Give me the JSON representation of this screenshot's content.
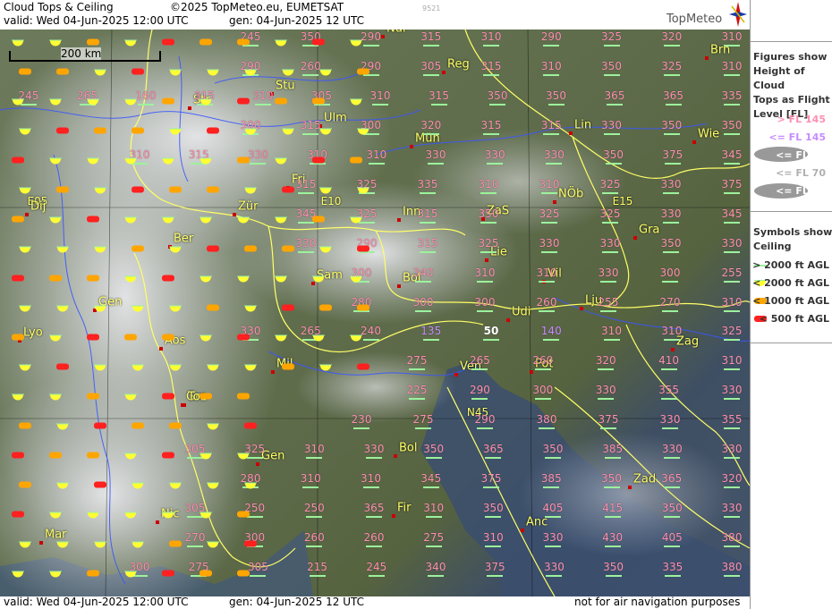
{
  "header": {
    "title": "Cloud Tops & Ceiling",
    "copyright": "©2025 TopMeteo.eu, EUMETSAT",
    "valid": "valid:  Wed  04-Jun-2025  12:00 UTC",
    "generated": "gen: 04-Jun-2025 12 UTC",
    "small_id": "9521",
    "logo": "TopMeteo"
  },
  "footer": {
    "valid": "valid:  Wed  04-Jun-2025  12:00 UTC",
    "generated": "gen:  04-Jun-2025 12 UTC",
    "note": "not for air navigation purposes"
  },
  "map": {
    "scale_label": "200 km",
    "grid_labels": [
      "E05",
      "E10",
      "E15",
      "N45"
    ],
    "cities": [
      "Nür",
      "Reg",
      "Brn",
      "Stu",
      "Str",
      "Ulm",
      "Mün",
      "Lin",
      "Wie",
      "Fri",
      "Zür",
      "Inn",
      "ZaS",
      "NÖb",
      "Dij",
      "Ber",
      "Lie",
      "Gra",
      "Bol",
      "Vil",
      "Gen",
      "Sam",
      "Lju",
      "Udi",
      "Lyo",
      "Aos",
      "Zag",
      "Mil",
      "Ven",
      "Pot",
      "Gre",
      "Tor",
      "Bol",
      "Gen",
      "Zad",
      "Nic",
      "Fir",
      "Mar",
      "Anc"
    ],
    "cloud_top_rows": [
      [
        "245",
        "350",
        "290",
        "315",
        "310",
        "290",
        "325",
        "320",
        "310"
      ],
      [
        "290",
        "260",
        "290",
        "305",
        "315",
        "310",
        "350",
        "325",
        "310"
      ],
      [
        "245",
        "265",
        "160",
        "315",
        "310",
        "305",
        "310",
        "315",
        "350",
        "350",
        "365",
        "365",
        "335"
      ],
      [
        "300",
        "315",
        "300",
        "320",
        "315",
        "315",
        "330",
        "350",
        "350"
      ],
      [
        "310",
        "315",
        "330",
        "310",
        "310",
        "330",
        "330",
        "330",
        "350",
        "375",
        "345"
      ],
      [
        "315",
        "325",
        "335",
        "310",
        "310",
        "325",
        "330",
        "375"
      ],
      [
        "345",
        "325",
        "315",
        "350",
        "325",
        "325",
        "330",
        "345"
      ],
      [
        "330",
        "290",
        "315",
        "325",
        "330",
        "330",
        "350",
        "330"
      ],
      [
        "300",
        "340",
        "310",
        "310",
        "330",
        "300",
        "255"
      ],
      [
        "280",
        "300",
        "300",
        "260",
        "255",
        "270",
        "310"
      ],
      [
        "330",
        "265",
        "240",
        "135",
        "50",
        "140",
        "310",
        "310",
        "325"
      ],
      [
        "275",
        "265",
        "260",
        "320",
        "410",
        "310"
      ],
      [
        "225",
        "290",
        "300",
        "330",
        "355",
        "330"
      ],
      [
        "230",
        "275",
        "290",
        "380",
        "375",
        "330",
        "355"
      ],
      [
        "305",
        "325",
        "310",
        "330",
        "350",
        "365",
        "350",
        "385",
        "330",
        "330"
      ],
      [
        "280",
        "310",
        "310",
        "345",
        "375",
        "385",
        "350",
        "365",
        "320"
      ],
      [
        "305",
        "250",
        "250",
        "365",
        "310",
        "350",
        "405",
        "415",
        "350",
        "330"
      ],
      [
        "270",
        "300",
        "260",
        "260",
        "275",
        "310",
        "330",
        "430",
        "405",
        "380"
      ],
      [
        "300",
        "275",
        "305",
        "215",
        "245",
        "340",
        "375",
        "330",
        "350",
        "335",
        "380"
      ]
    ]
  },
  "legend": {
    "header1": [
      "Figures show",
      "Height of Cloud",
      "Tops as Flight",
      "Level  [FL]"
    ],
    "fl_items": [
      {
        "label": "> FL 145",
        "color": "#ff8fb0"
      },
      {
        "label": "<= FL 145",
        "color": "#c78cff"
      },
      {
        "label": "<= FL 90",
        "color": "#ffffff"
      },
      {
        "label": "<= FL 70",
        "color": "#b0b0b0"
      },
      {
        "label": "<= FL 50",
        "color": "#ffffff"
      }
    ],
    "header2": [
      "Symbols show",
      "Ceiling"
    ],
    "ceiling_items": [
      {
        "label": "> 2000 ft AGL",
        "color": "#9cf29c",
        "shape": "dash"
      },
      {
        "label": "< 2000 ft AGL",
        "color": "#ffff33",
        "shape": "half-circle"
      },
      {
        "label": "< 1000 ft AGL",
        "color": "#ffa500",
        "shape": "pill"
      },
      {
        "label": "< 500 ft AGL",
        "color": "#ff2020",
        "shape": "pill"
      }
    ]
  }
}
